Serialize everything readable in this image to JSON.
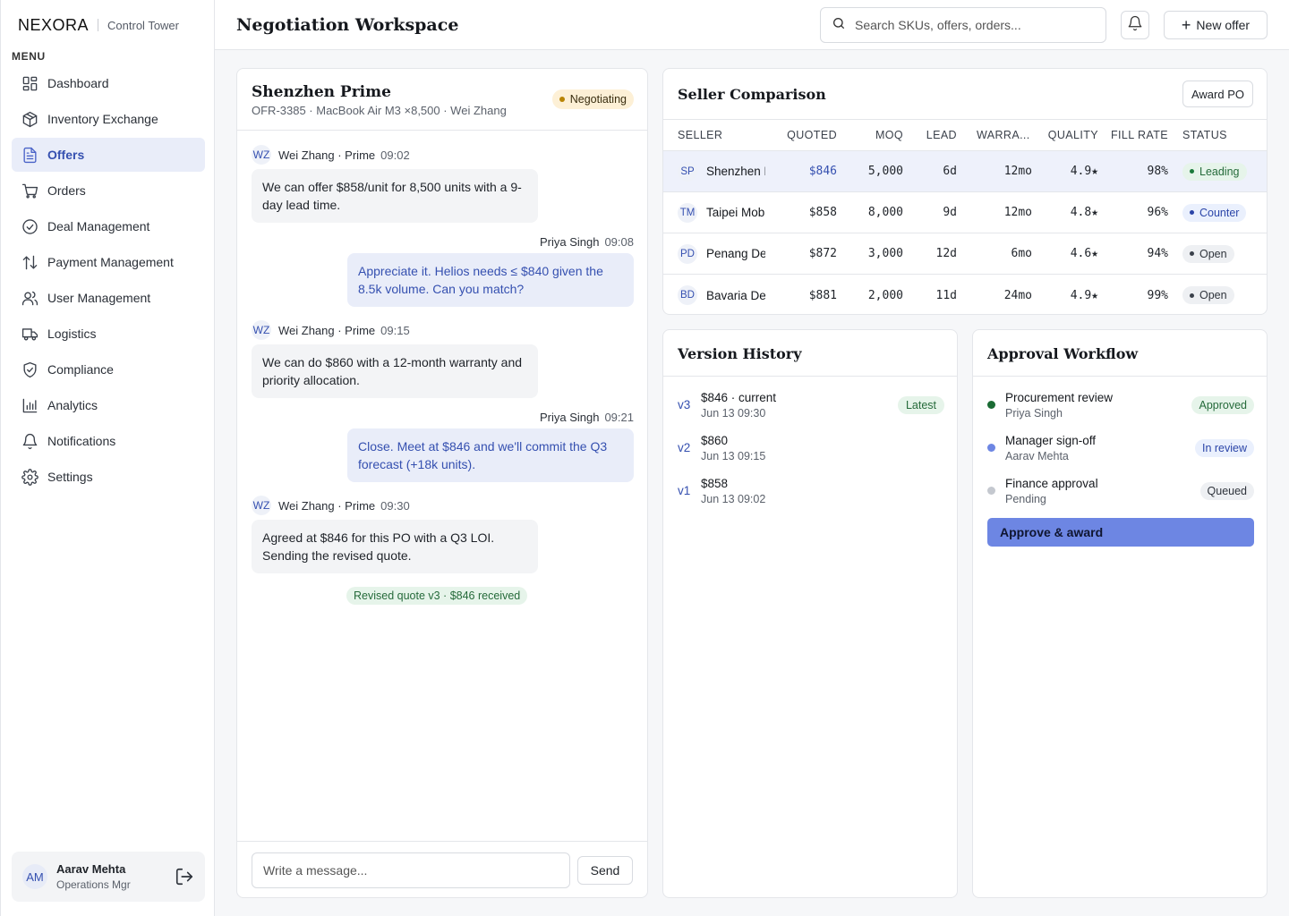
{
  "brand": {
    "name": "NEXORA",
    "subtitle": "Control Tower"
  },
  "sidebar": {
    "heading": "MENU",
    "items": [
      {
        "label": "Dashboard",
        "icon": "dashboard-icon"
      },
      {
        "label": "Inventory Exchange",
        "icon": "box-icon"
      },
      {
        "label": "Offers",
        "icon": "document-icon",
        "active": true
      },
      {
        "label": "Orders",
        "icon": "cart-icon"
      },
      {
        "label": "Deal Management",
        "icon": "check-circle-icon"
      },
      {
        "label": "Payment Management",
        "icon": "transfer-arrows-icon"
      },
      {
        "label": "User Management",
        "icon": "users-icon"
      },
      {
        "label": "Logistics",
        "icon": "truck-icon"
      },
      {
        "label": "Compliance",
        "icon": "shield-check-icon"
      },
      {
        "label": "Analytics",
        "icon": "bar-chart-icon"
      },
      {
        "label": "Notifications",
        "icon": "bell-icon"
      },
      {
        "label": "Settings",
        "icon": "gear-icon"
      }
    ],
    "user": {
      "initials": "AM",
      "name": "Aarav Mehta",
      "role": "Operations Mgr"
    }
  },
  "header": {
    "title": "Negotiation Workspace",
    "search_placeholder": "Search SKUs, offers, orders...",
    "new_offer_label": "New offer"
  },
  "chat": {
    "title": "Shenzhen Prime",
    "meta": "OFR-3385 · MacBook Air M3 ×8,500 · Wei Zhang",
    "status": "Negotiating",
    "messages": [
      {
        "from": "in",
        "initials": "WZ",
        "sender": "Wei Zhang · Prime",
        "time": "09:02",
        "text": "We can offer $858/unit for 8,500 units with a 9-day lead time."
      },
      {
        "from": "out",
        "sender": "Priya Singh",
        "time": "09:08",
        "text": "Appreciate it. Helios needs ≤ $840 given the 8.5k volume. Can you match?"
      },
      {
        "from": "in",
        "initials": "WZ",
        "sender": "Wei Zhang · Prime",
        "time": "09:15",
        "text": "We can do $860 with a 12-month warranty and priority allocation."
      },
      {
        "from": "out",
        "sender": "Priya Singh",
        "time": "09:21",
        "text": "Close. Meet at $846 and we'll commit the Q3 forecast (+18k units)."
      },
      {
        "from": "in",
        "initials": "WZ",
        "sender": "Wei Zhang · Prime",
        "time": "09:30",
        "text": "Agreed at $846 for this PO with a Q3 LOI. Sending the revised quote."
      }
    ],
    "receipt": "Revised quote v3 · $846 received",
    "composer_placeholder": "Write a message...",
    "send_label": "Send"
  },
  "comparison": {
    "title": "Seller Comparison",
    "award_label": "Award PO",
    "columns": [
      "SELLER",
      "QUOTED",
      "MOQ",
      "LEAD",
      "WARRA...",
      "QUALITY",
      "FILL RATE",
      "STATUS"
    ],
    "rows": [
      {
        "initials": "SP",
        "seller": "Shenzhen Prime",
        "quoted": "$846",
        "moq": "5,000",
        "lead": "6d",
        "warranty": "12mo",
        "quality": "4.9★",
        "fill": "98%",
        "status": "Leading",
        "status_kind": "lead",
        "selected": true
      },
      {
        "initials": "TM",
        "seller": "Taipei Mobile",
        "quoted": "$858",
        "moq": "8,000",
        "lead": "9d",
        "warranty": "12mo",
        "quality": "4.8★",
        "fill": "96%",
        "status": "Counter",
        "status_kind": "counter"
      },
      {
        "initials": "PD",
        "seller": "Penang Devices",
        "quoted": "$872",
        "moq": "3,000",
        "lead": "12d",
        "warranty": "6mo",
        "quality": "4.6★",
        "fill": "94%",
        "status": "Open",
        "status_kind": "open"
      },
      {
        "initials": "BD",
        "seller": "Bavaria Devices",
        "quoted": "$881",
        "moq": "2,000",
        "lead": "11d",
        "warranty": "24mo",
        "quality": "4.9★",
        "fill": "99%",
        "status": "Open",
        "status_kind": "open"
      }
    ]
  },
  "versions": {
    "title": "Version History",
    "items": [
      {
        "tag": "v3",
        "price": "$846 · current",
        "date": "Jun 13 09:30",
        "badge": "Latest"
      },
      {
        "tag": "v2",
        "price": "$860",
        "date": "Jun 13 09:15"
      },
      {
        "tag": "v1",
        "price": "$858",
        "date": "Jun 13 09:02"
      }
    ]
  },
  "approval": {
    "title": "Approval Workflow",
    "steps": [
      {
        "title": "Procurement review",
        "person": "Priya Singh",
        "badge": "Approved",
        "kind": "approved",
        "color": "#1a6b34"
      },
      {
        "title": "Manager sign-off",
        "person": "Aarav Mehta",
        "badge": "In review",
        "kind": "review",
        "color": "#6d86e3"
      },
      {
        "title": "Finance approval",
        "person": "Pending",
        "badge": "Queued",
        "kind": "queued",
        "color": "#c4c8cf"
      }
    ],
    "action_label": "Approve & award"
  },
  "colors": {
    "accent": "#3550b0",
    "primary_button": "#6d86e3",
    "success": "#256a3a",
    "warning": "#b88404"
  }
}
